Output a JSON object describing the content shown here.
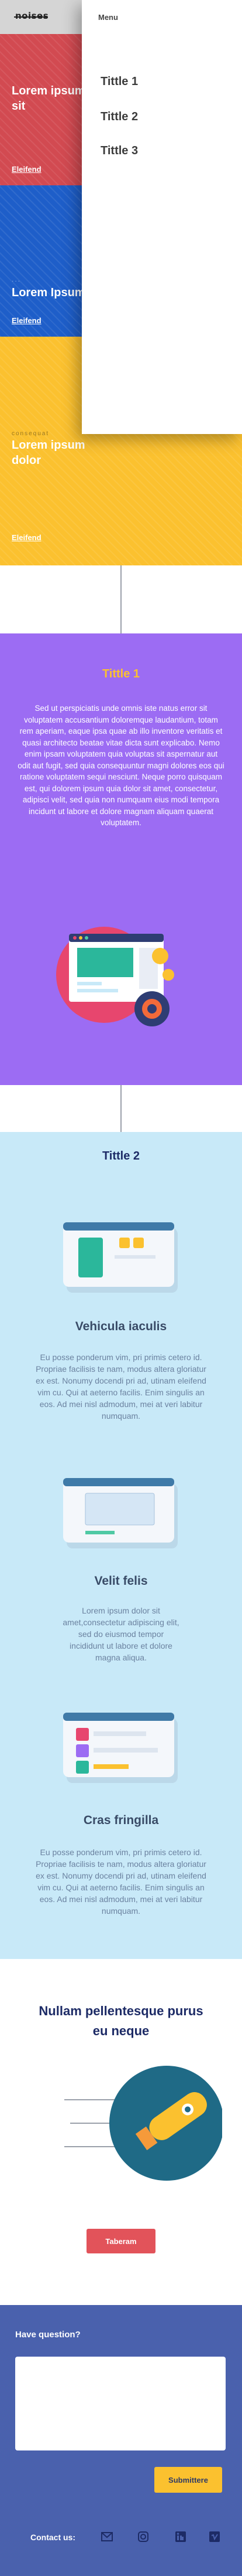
{
  "header": {
    "logo": "noises"
  },
  "menu": {
    "label": "Menu",
    "items": [
      "Tittle 1",
      "Tittle 2",
      "Tittle 3"
    ]
  },
  "tiles": [
    {
      "title": "Lorem ipsum sit",
      "small": "",
      "link": "Eleifend",
      "color": "#d24a51"
    },
    {
      "title": "Lorem Ipsum",
      "small": "···",
      "link": "Eleifend",
      "color": "#1e5ec9"
    },
    {
      "title": "Lorem ipsum dolor",
      "small": "consequat",
      "link": "Eleifend",
      "color": "#fbc12f"
    }
  ],
  "section1": {
    "title": "Tittle 1",
    "text": "Sed ut perspiciatis unde omnis iste natus error sit voluptatem accusantium doloremque laudantium, totam rem aperiam, eaque ipsa quae ab illo inventore veritatis et quasi architecto beatae vitae dicta sunt explicabo. Nemo enim ipsam voluptatem quia voluptas sit aspernatur aut odit aut fugit, sed quia consequuntur magni dolores eos qui ratione voluptatem sequi nesciunt. Neque porro quisquam est, qui dolorem ipsum quia dolor sit amet, consectetur, adipisci velit, sed quia non numquam eius modi tempora incidunt ut labore et dolore magnam aliquam quaerat voluptatem."
  },
  "section2": {
    "title": "Tittle 2",
    "features": [
      {
        "title": "Vehicula iaculis",
        "text": "Eu posse ponderum vim, pri primis cetero id. Propriae facilisis te nam, modus altera gloriatur ex est. Nonumy docendi pri ad, utinam eleifend vim cu. Qui at aeterno facilis. Enim singulis an eos. Ad mei nisl admodum, mei at veri labitur numquam."
      },
      {
        "title": "Velit felis",
        "text": "Lorem ipsum dolor sit amet,consectetur adipiscing elit, sed do eiusmod tempor incididunt ut labore et dolore magna aliqua."
      },
      {
        "title": "Cras fringilla",
        "text": "Eu posse ponderum vim, pri primis cetero id. Propriae facilisis te nam, modus altera gloriatur ex est. Nonumy docendi pri ad, utinam eleifend vim cu. Qui at aeterno facilis. Enim singulis an eos. Ad mei nisl admodum, mei at veri labitur numquam."
      }
    ]
  },
  "cta": {
    "title": "Nullam pellentesque purus eu neque",
    "button": "Taberam"
  },
  "footer": {
    "question": "Have question?",
    "textarea_placeholder": "",
    "submit": "Submittere",
    "contact": "Contact us:",
    "social": [
      "mail-icon",
      "instagram-icon",
      "linkedin-icon",
      "vimeo-icon"
    ]
  },
  "colors": {
    "red": "#d24a51",
    "blue": "#1e5ec9",
    "yellow": "#fbc12f",
    "purple": "#9c6cf3",
    "lightblue": "#c8e9f8",
    "navy": "#1d2b66",
    "footer": "#4a61ad"
  }
}
